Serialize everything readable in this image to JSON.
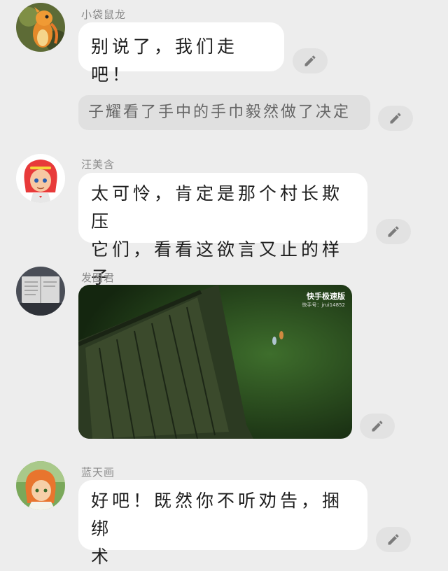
{
  "messages": [
    {
      "type": "chat",
      "name": "小袋鼠龙",
      "text": "别说了，我们走吧！",
      "avatar": "orange-dragon-avatar"
    },
    {
      "type": "narration",
      "text": "子耀看了手中的手巾毅然做了决定"
    },
    {
      "type": "chat",
      "name": "汪美含",
      "text_lines": [
        "太可怜，肯定是那个村长欺压",
        "它们，看看这欲言又止的样子"
      ],
      "avatar": "red-hair-girl-avatar"
    },
    {
      "type": "video",
      "name": "发图君",
      "avatar": "notebook-avatar",
      "watermark_brand": "快手极速版",
      "watermark_id": "快手号：jrui14852"
    },
    {
      "type": "chat",
      "name": "蓝天画",
      "text_lines": [
        "好吧！既然你不听劝告，捆绑",
        "术"
      ],
      "avatar": "orange-hair-girl-avatar"
    }
  ],
  "icons": {
    "edit": "pencil-icon"
  },
  "colors": {
    "background": "#ededed",
    "bubble": "#ffffff",
    "narration": "#e0e0e0",
    "edit_button": "#e2e2e2"
  }
}
